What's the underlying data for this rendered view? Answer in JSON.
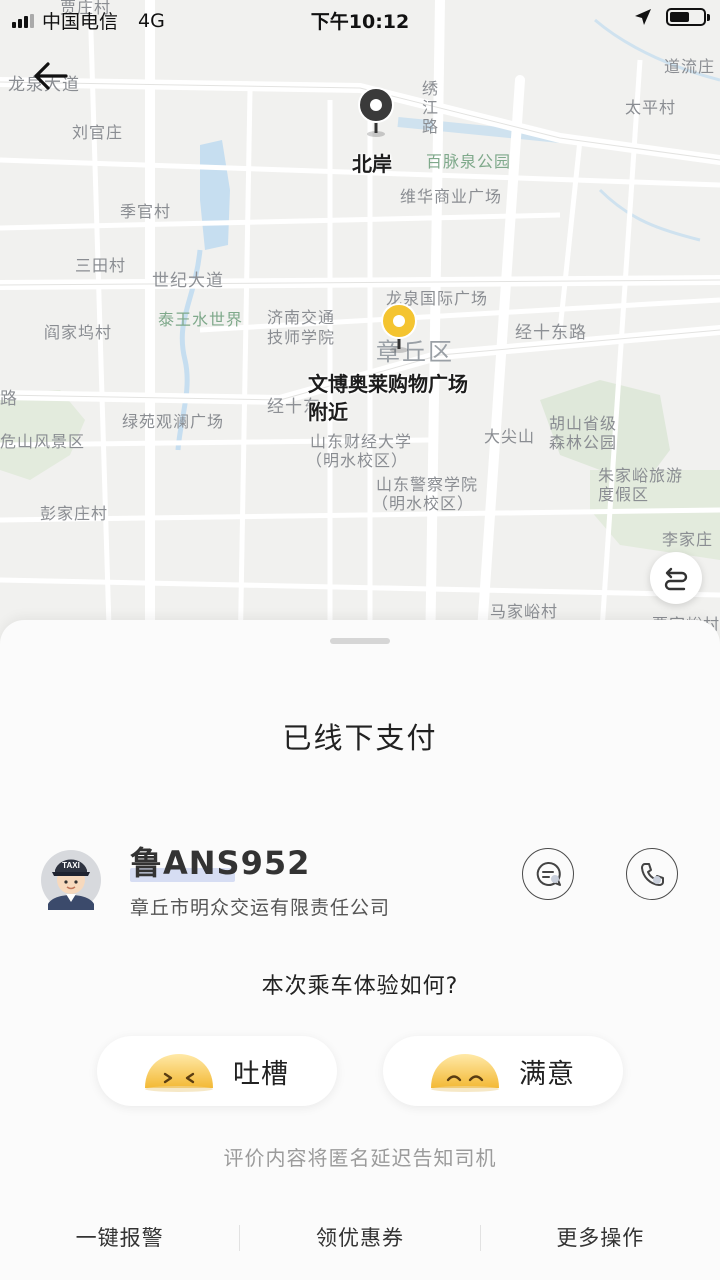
{
  "status_bar": {
    "carrier": "中国电信",
    "network": "4G",
    "time": "下午10:12"
  },
  "map": {
    "origin_label": "北岸",
    "destination_label_line1": "文博奥莱购物广场",
    "destination_label_line2": "附近",
    "district": "章丘区",
    "labels": {
      "longquan_ave": "龙泉大道",
      "liuguanzhuang": "刘官庄",
      "jiguancun": "季官村",
      "santiancun": "三田村",
      "shiji_ave": "世纪大道",
      "yanjiawucun": "阎家坞村",
      "taiwang_water": "泰王水世界",
      "jinan_jiaotong_1": "济南交通",
      "jinan_jiaotong_2": "技师学院",
      "longquan_plaza": "龙泉国际广场",
      "xiuzhuang_road_1": "绣",
      "xiuzhuang_road_2": "江",
      "xiuzhuang_road_3": "路",
      "baimai_park": "百脉泉公园",
      "weihua_plaza": "维华商业广场",
      "daoliuzhuang": "道流庄",
      "taipingcun": "太平村",
      "jingshi_east": "经十东路",
      "jingshi_road": "经十东",
      "lu_left": "路",
      "lvyuan_plaza": "绿苑观澜广场",
      "weishan_scenic": "危山风景区",
      "sdcj_1": "山东财经大学",
      "sdcj_2": "（明水校区）",
      "sdjc_1": "山东警察学院",
      "sdjc_2": "（明水校区）",
      "dajianshan": "大尖山",
      "hushan_1": "胡山省级",
      "hushan_2": "森林公园",
      "zhujiayu_1": "朱家峪旅游",
      "zhujiayu_2": "度假区",
      "pengjiazhuang": "彭家庄村",
      "lijiazhuang": "李家庄",
      "majiayucun": "马家峪村",
      "jiajiayu": "贾家峪村",
      "top_cut": "贾庄村"
    },
    "colors": {
      "origin_pin": "#3a3a3a",
      "destination_pin": "#f4c430",
      "park_green": "#dfe8da",
      "water": "#c6def0"
    }
  },
  "sheet": {
    "payment_status": "已线下支付",
    "driver": {
      "plate": "鲁ANS952",
      "company": "章丘市明众交运有限责任公司",
      "avatar_cap_text": "TAXI"
    },
    "rating_question": "本次乘车体验如何?",
    "rating_buttons": {
      "complain": "吐槽",
      "satisfied": "满意"
    },
    "anonymous_note": "评价内容将匿名延迟告知司机",
    "actions": {
      "sos": "一键报警",
      "coupon": "领优惠券",
      "more": "更多操作"
    }
  }
}
